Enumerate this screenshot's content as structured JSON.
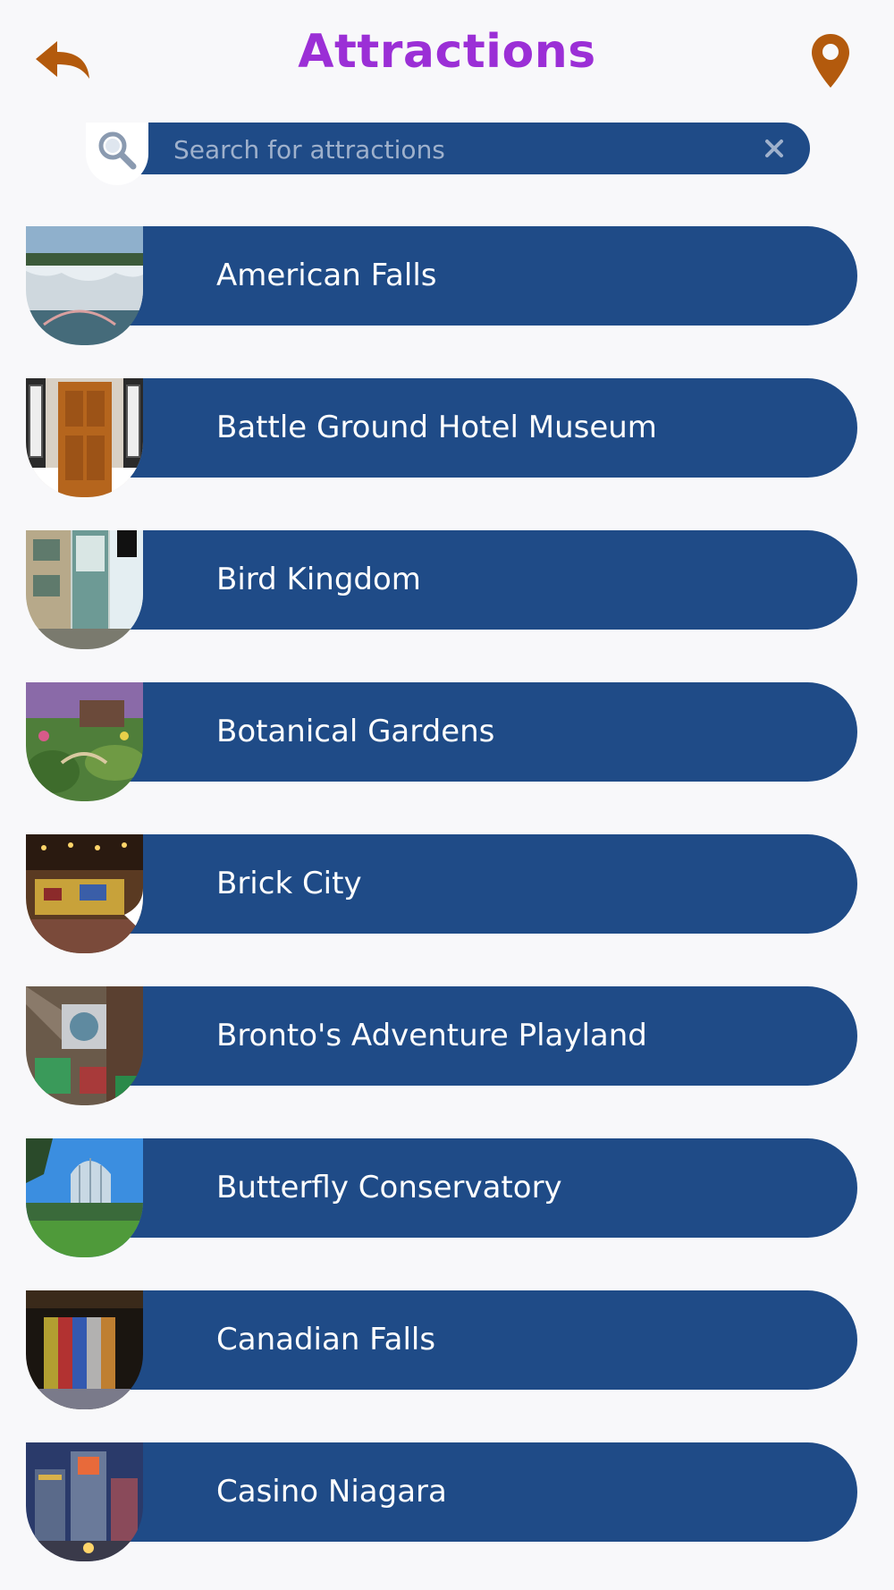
{
  "header": {
    "title": "Attractions",
    "back_icon": "back-arrow-icon",
    "location_icon": "map-pin-icon",
    "accent_color": "#9b2fd6",
    "icon_color": "#b35a0d"
  },
  "search": {
    "placeholder": "Search for attractions",
    "value": "",
    "search_icon": "search-icon",
    "clear_icon": "close-icon"
  },
  "theme": {
    "pill_color": "#1f4b87",
    "background": "#f8f8fa"
  },
  "attractions": [
    {
      "name": "American Falls"
    },
    {
      "name": "Battle Ground Hotel Museum"
    },
    {
      "name": "Bird Kingdom"
    },
    {
      "name": "Botanical Gardens"
    },
    {
      "name": "Brick City"
    },
    {
      "name": "Bronto's Adventure Playland"
    },
    {
      "name": "Butterfly Conservatory"
    },
    {
      "name": "Canadian Falls"
    },
    {
      "name": "Casino Niagara"
    }
  ]
}
